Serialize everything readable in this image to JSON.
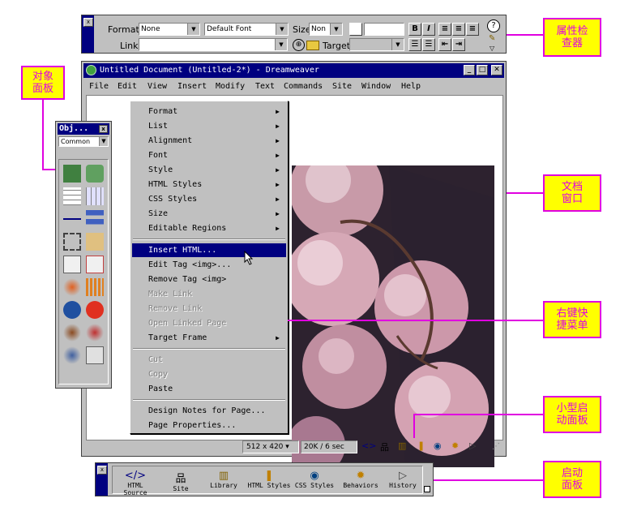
{
  "callouts": {
    "property_inspector": [
      "属性检",
      "查器"
    ],
    "objects_panel": [
      "对象",
      "面板"
    ],
    "document_window": [
      "文档",
      "窗口"
    ],
    "context_menu": [
      "右键快",
      "捷菜单"
    ],
    "mini_launcher": [
      "小型启",
      "动面板"
    ],
    "launcher": [
      "启动",
      "面板"
    ]
  },
  "property_inspector": {
    "format_label": "Format",
    "format_value": "None",
    "font_value": "Default Font",
    "size_label": "Size",
    "size_value": "Non",
    "link_label": "Link",
    "link_value": "",
    "target_label": "Target",
    "target_value": "",
    "bold": "B",
    "italic": "I",
    "help": "?",
    "icons": [
      "align-left-icon",
      "align-center-icon",
      "align-right-icon",
      "unordered-list-icon",
      "ordered-list-icon",
      "outdent-icon",
      "indent-icon",
      "point-to-file-icon",
      "folder-icon",
      "quick-tag-editor-icon",
      "expand-arrow-icon"
    ]
  },
  "window": {
    "title": "Untitled Document (Untitled-2*) - Dreamweaver",
    "menu": [
      "File",
      "Edit",
      "View",
      "Insert",
      "Modify",
      "Text",
      "Commands",
      "Site",
      "Window",
      "Help"
    ],
    "min": "_",
    "max": "□",
    "close": "✕"
  },
  "status": {
    "window_size": "512 x 420",
    "download": "20K / 6 sec",
    "mini_launcher_icons": [
      "html-source-icon",
      "site-icon",
      "library-icon",
      "html-styles-icon",
      "css-styles-icon",
      "behaviors-icon",
      "history-icon"
    ]
  },
  "context_menu": {
    "items": [
      {
        "label": "Format",
        "submenu": true,
        "enabled": true
      },
      {
        "label": "List",
        "submenu": true,
        "enabled": true
      },
      {
        "label": "Alignment",
        "submenu": true,
        "enabled": true
      },
      {
        "label": "Font",
        "submenu": true,
        "enabled": true
      },
      {
        "label": "Style",
        "submenu": true,
        "enabled": true
      },
      {
        "label": "HTML Styles",
        "submenu": true,
        "enabled": true
      },
      {
        "label": "CSS Styles",
        "submenu": true,
        "enabled": true
      },
      {
        "label": "Size",
        "submenu": true,
        "enabled": true
      },
      {
        "label": "Editable Regions",
        "submenu": true,
        "enabled": true
      },
      {
        "label": "Insert HTML...",
        "submenu": false,
        "enabled": true,
        "selected": true
      },
      {
        "label": "Edit Tag <img>...",
        "submenu": false,
        "enabled": true
      },
      {
        "label": "Remove Tag <img>",
        "submenu": false,
        "enabled": true
      },
      {
        "label": "Make Link",
        "submenu": false,
        "enabled": false
      },
      {
        "label": "Remove Link",
        "submenu": false,
        "enabled": false
      },
      {
        "label": "Open Linked Page",
        "submenu": false,
        "enabled": false
      },
      {
        "label": "Target Frame",
        "submenu": true,
        "enabled": true
      },
      {
        "label": "Cut",
        "submenu": false,
        "enabled": false
      },
      {
        "label": "Copy",
        "submenu": false,
        "enabled": false
      },
      {
        "label": "Paste",
        "submenu": false,
        "enabled": true
      },
      {
        "label": "Design Notes for Page...",
        "submenu": false,
        "enabled": true
      },
      {
        "label": "Page Properties...",
        "submenu": false,
        "enabled": true
      }
    ]
  },
  "objects_panel": {
    "title": "Obj...",
    "category": "Common",
    "icons": [
      "insert-image-icon",
      "insert-rollover-image-icon",
      "insert-table-icon",
      "insert-tabular-data-icon",
      "insert-horizontal-rule-icon",
      "insert-navigation-bar-icon",
      "insert-layer-icon",
      "insert-line-break-icon",
      "insert-email-link-icon",
      "insert-date-icon",
      "insert-flash-icon",
      "insert-fireworks-html-icon",
      "insert-shockwave-icon",
      "insert-generator-icon",
      "insert-applet-icon",
      "insert-activex-icon",
      "insert-plugin-icon",
      "insert-server-side-include-icon"
    ]
  },
  "launcher": {
    "items": [
      "HTML Source",
      "Site",
      "Library",
      "HTML Styles",
      "CSS Styles",
      "Behaviors",
      "History"
    ]
  }
}
